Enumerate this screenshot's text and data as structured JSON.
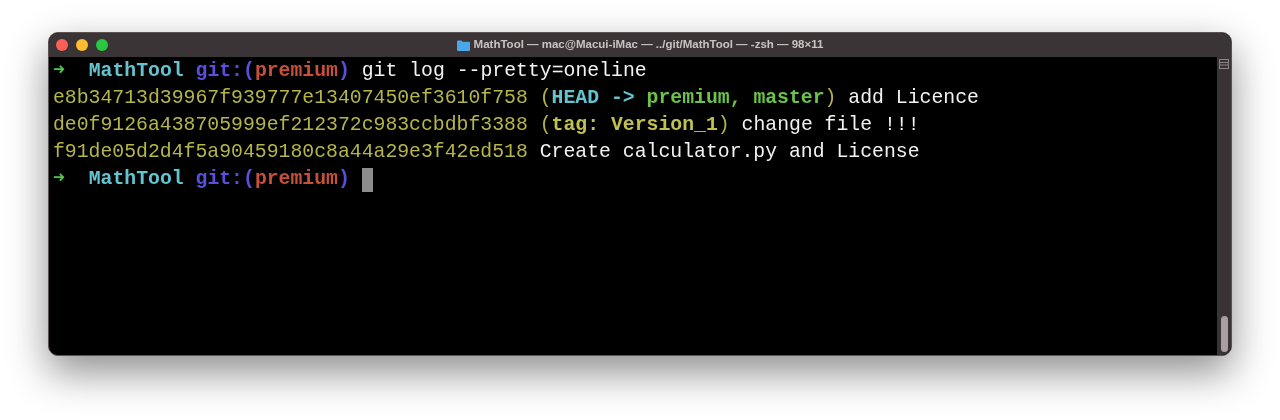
{
  "window": {
    "title": "MathTool — mac@Macui-iMac — ../git/MathTool — -zsh — 98×11"
  },
  "terminal": {
    "lines": [
      {
        "cursor": false,
        "segments": [
          {
            "kind": "arrow",
            "text": "➜"
          },
          {
            "kind": "dir",
            "text": "  MathTool"
          },
          {
            "kind": "vcs",
            "text": " git:("
          },
          {
            "kind": "branch",
            "text": "premium"
          },
          {
            "kind": "vcs",
            "text": ")"
          },
          {
            "kind": "plain",
            "text": " git log --pretty=oneline"
          }
        ]
      },
      {
        "cursor": false,
        "segments": [
          {
            "kind": "hash",
            "text": "e8b34713d39967f939777e13407450ef3610f758"
          },
          {
            "kind": "ref",
            "text": " ("
          },
          {
            "kind": "head",
            "text": "HEAD -> "
          },
          {
            "kind": "local",
            "text": "premium, master"
          },
          {
            "kind": "ref",
            "text": ")"
          },
          {
            "kind": "plain",
            "text": " add Licence"
          }
        ]
      },
      {
        "cursor": false,
        "segments": [
          {
            "kind": "hash",
            "text": "de0f9126a438705999ef212372c983ccbdbf3388"
          },
          {
            "kind": "ref",
            "text": " ("
          },
          {
            "kind": "tag",
            "text": "tag: Version_1"
          },
          {
            "kind": "ref",
            "text": ")"
          },
          {
            "kind": "plain",
            "text": " change file !!!"
          }
        ]
      },
      {
        "cursor": false,
        "segments": [
          {
            "kind": "hash",
            "text": "f91de05d2d4f5a90459180c8a44a29e3f42ed518"
          },
          {
            "kind": "plain",
            "text": " Create calculator.py and License"
          }
        ]
      },
      {
        "cursor": true,
        "segments": [
          {
            "kind": "arrow",
            "text": "➜"
          },
          {
            "kind": "dir",
            "text": "  MathTool"
          },
          {
            "kind": "vcs",
            "text": " git:("
          },
          {
            "kind": "branch",
            "text": "premium"
          },
          {
            "kind": "vcs",
            "text": ") "
          }
        ]
      }
    ]
  }
}
